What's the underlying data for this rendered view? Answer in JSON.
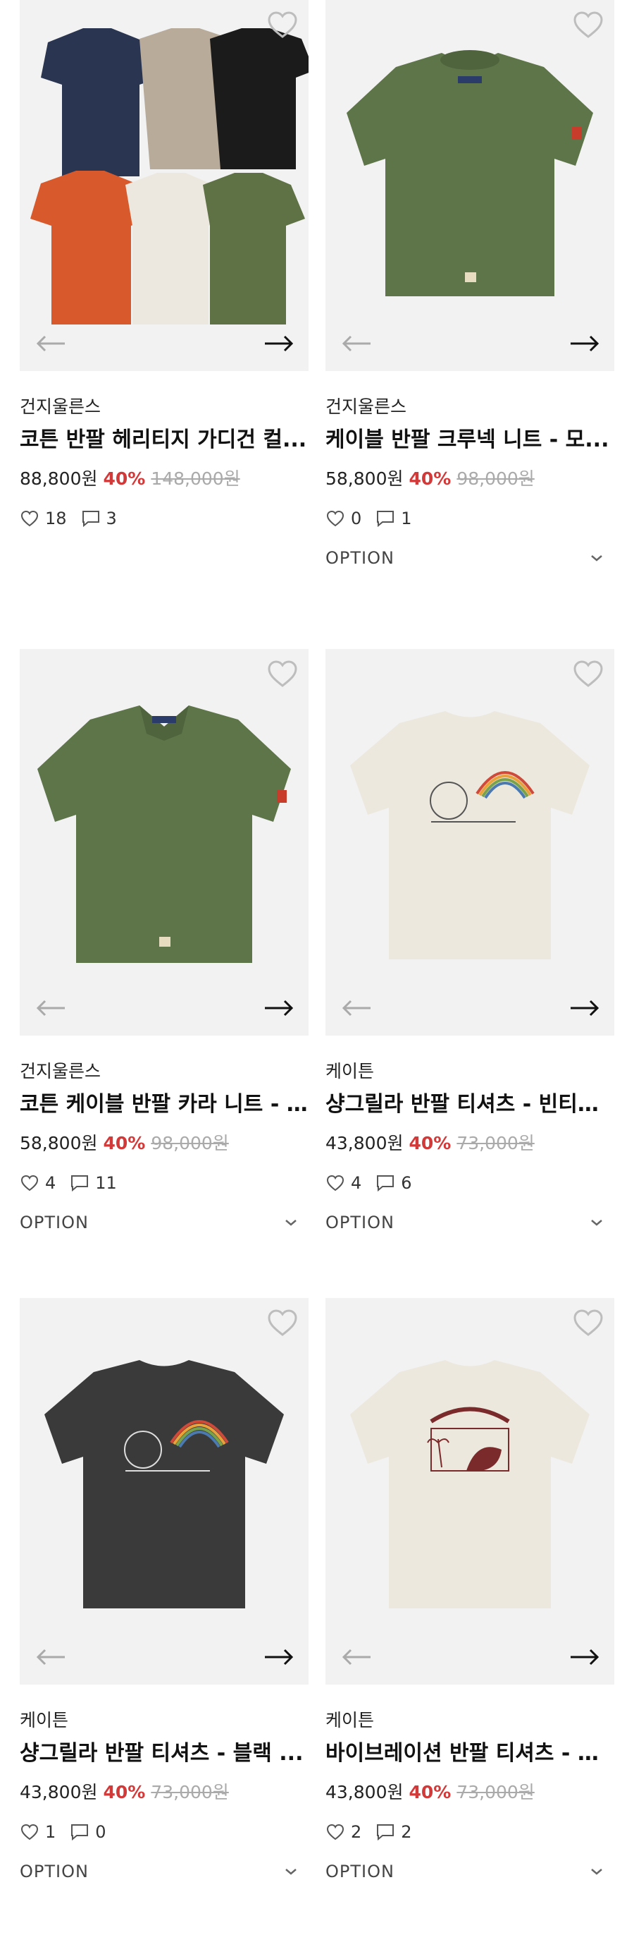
{
  "colors": {
    "discount": "#d23a3a",
    "strike": "#aaaaaa",
    "image_bg": "#f2f2f2"
  },
  "products": [
    {
      "brand": "건지울른스",
      "title": "코튼 반팔 헤리티지 가디건 컬...",
      "price": "88,800원",
      "discount": "40%",
      "original_price": "148,000원",
      "likes": "18",
      "comments": "3",
      "option_label": "",
      "image_desc": "cardigan-colorways"
    },
    {
      "brand": "건지울른스",
      "title": "케이블 반팔 크루넥 니트 - 모...",
      "price": "58,800원",
      "discount": "40%",
      "original_price": "98,000원",
      "likes": "0",
      "comments": "1",
      "option_label": "OPTION",
      "image_desc": "green-crewneck-knit"
    },
    {
      "brand": "건지울른스",
      "title": "코튼 케이블 반팔 카라 니트 - ...",
      "price": "58,800원",
      "discount": "40%",
      "original_price": "98,000원",
      "likes": "4",
      "comments": "11",
      "option_label": "OPTION",
      "image_desc": "green-collar-knit"
    },
    {
      "brand": "케이튼",
      "title": "샹그릴라 반팔 티셔츠 - 빈티지...",
      "price": "43,800원",
      "discount": "40%",
      "original_price": "73,000원",
      "likes": "4",
      "comments": "6",
      "option_label": "OPTION",
      "image_desc": "cream-tshirt-rainbow"
    },
    {
      "brand": "케이튼",
      "title": "샹그릴라 반팔 티셔츠 - 블랙 ...",
      "price": "43,800원",
      "discount": "40%",
      "original_price": "73,000원",
      "likes": "1",
      "comments": "0",
      "option_label": "OPTION",
      "image_desc": "black-tshirt-rainbow"
    },
    {
      "brand": "케이튼",
      "title": "바이브레이션 반팔 티셔츠 - 빈...",
      "price": "43,800원",
      "discount": "40%",
      "original_price": "73,000원",
      "likes": "2",
      "comments": "2",
      "option_label": "OPTION",
      "image_desc": "cream-tshirt-good-vibrations"
    }
  ],
  "icons": {
    "favorite": "heart-outline-icon",
    "prev": "arrow-left-icon",
    "next": "arrow-right-icon",
    "like": "heart-icon",
    "comment": "comment-icon",
    "option": "chevron-down-icon"
  }
}
